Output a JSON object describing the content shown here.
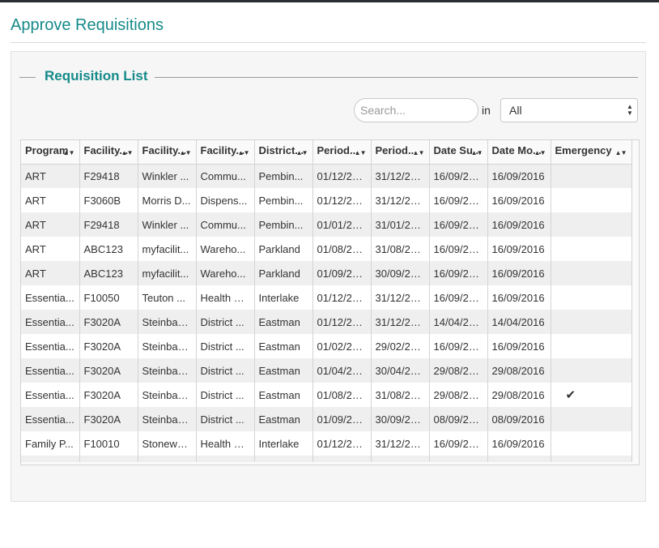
{
  "page": {
    "title": "Approve Requisitions"
  },
  "panel": {
    "legend": "Requisition List"
  },
  "search": {
    "placeholder": "Search...",
    "value": "",
    "in_label": "in",
    "scope_selected": "All"
  },
  "table": {
    "columns": [
      "Program",
      "Facility...",
      "Facility...",
      "Facility...",
      "District...",
      "Period...",
      "Period...",
      "Date Su...",
      "Date Mo...",
      "Emergency"
    ],
    "rows": [
      [
        "ART",
        "F29418",
        "Winkler ...",
        "Commu...",
        "Pembin...",
        "01/12/20...",
        "31/12/20...",
        "16/09/20...",
        "16/09/2016",
        ""
      ],
      [
        "ART",
        "F3060B",
        "Morris D...",
        "Dispens...",
        "Pembin...",
        "01/12/20...",
        "31/12/20...",
        "16/09/20...",
        "16/09/2016",
        ""
      ],
      [
        "ART",
        "F29418",
        "Winkler ...",
        "Commu...",
        "Pembin...",
        "01/01/20...",
        "31/01/20...",
        "16/09/20...",
        "16/09/2016",
        ""
      ],
      [
        "ART",
        "ABC123",
        "myfacilit...",
        "Wareho...",
        "Parkland",
        "01/08/20...",
        "31/08/20...",
        "16/09/20...",
        "16/09/2016",
        ""
      ],
      [
        "ART",
        "ABC123",
        "myfacilit...",
        "Wareho...",
        "Parkland",
        "01/09/20...",
        "30/09/20...",
        "16/09/20...",
        "16/09/2016",
        ""
      ],
      [
        "Essentia...",
        "F10050",
        "Teuton ...",
        "Health C...",
        "Interlake",
        "01/12/20...",
        "31/12/20...",
        "16/09/20...",
        "16/09/2016",
        ""
      ],
      [
        "Essentia...",
        "F3020A",
        "Steinbac...",
        "District ...",
        "Eastman",
        "01/12/20...",
        "31/12/20...",
        "14/04/20...",
        "14/04/2016",
        ""
      ],
      [
        "Essentia...",
        "F3020A",
        "Steinbac...",
        "District ...",
        "Eastman",
        "01/02/20...",
        "29/02/20...",
        "16/09/20...",
        "16/09/2016",
        ""
      ],
      [
        "Essentia...",
        "F3020A",
        "Steinbac...",
        "District ...",
        "Eastman",
        "01/04/20...",
        "30/04/20...",
        "29/08/20...",
        "29/08/2016",
        ""
      ],
      [
        "Essentia...",
        "F3020A",
        "Steinbac...",
        "District ...",
        "Eastman",
        "01/08/20...",
        "31/08/20...",
        "29/08/20...",
        "29/08/2016",
        "✔"
      ],
      [
        "Essentia...",
        "F3020A",
        "Steinbac...",
        "District ...",
        "Eastman",
        "01/09/20...",
        "30/09/20...",
        "08/09/20...",
        "08/09/2016",
        ""
      ],
      [
        "Family P...",
        "F10010",
        "Stonewa...",
        "Health C...",
        "Interlake",
        "01/12/20...",
        "31/12/20...",
        "16/09/20...",
        "16/09/2016",
        ""
      ]
    ]
  },
  "icons": {
    "sort": "sort-arrows-icon",
    "select": "select-arrows-icon",
    "emergency": "checkmark-icon"
  },
  "colors": {
    "accent": "#168a8a",
    "row_alt": "#efefef",
    "border": "#d4d4d4",
    "topbar": "#2b2f33"
  }
}
